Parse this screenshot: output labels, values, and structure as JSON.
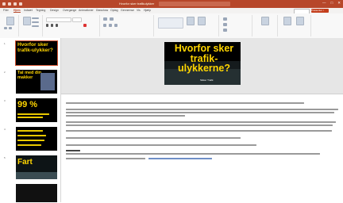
{
  "window": {
    "file_title": "Hvorfor sker trafikulykker",
    "user": "",
    "controls": [
      "—",
      "□",
      "✕"
    ]
  },
  "menu": {
    "tabs": [
      "Filer",
      "Hjem",
      "Indsæt",
      "Tegning",
      "Design",
      "Overgange",
      "Animationer",
      "Diasshow",
      "Optag",
      "Gennemse",
      "Vis",
      "Hjælp"
    ],
    "active_tab": "Hjem",
    "comment_label": "",
    "present_label": "Præsenter i Teams"
  },
  "slides": [
    {
      "num": "1",
      "title": "Hvorfor sker trafik-ulykker?",
      "selected": true
    },
    {
      "num": "2",
      "title": "Tal med din makker",
      "selected": false
    },
    {
      "num": "3",
      "title": "99 %",
      "selected": false
    },
    {
      "num": "4",
      "title": "",
      "selected": false
    },
    {
      "num": "5",
      "title": "Fart",
      "selected": false
    }
  ],
  "current_slide": {
    "title": "Hvorfor sker trafik-ulykkerne?",
    "logo": "Sikker Trafik"
  },
  "notes": {
    "heading": "Om forløbet",
    "link": "Trafikulykker og adfærd i trafikken"
  },
  "colors": {
    "brand": "#b7472a",
    "accent_yellow": "#ffd500",
    "slide_bg": "#000000"
  }
}
